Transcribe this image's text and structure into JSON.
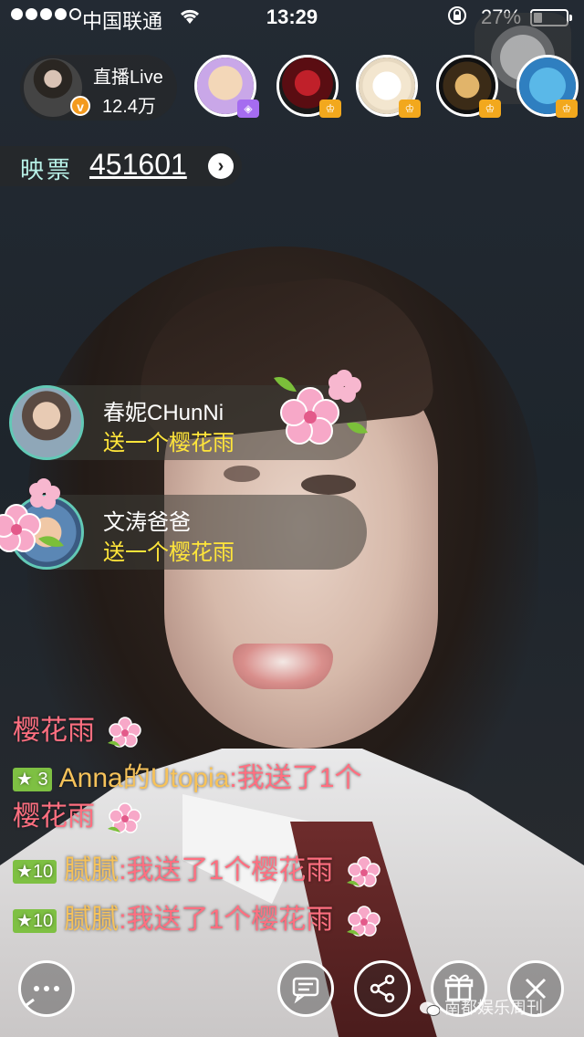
{
  "status_bar": {
    "carrier": "中国联通",
    "time": "13:29",
    "battery_percent": "27%",
    "battery_level": 0.27,
    "signal_bars": 4,
    "signal_max": 5
  },
  "host": {
    "title": "直播Live",
    "viewer_count": "12.4万",
    "badge": "v"
  },
  "viewers": [
    {
      "name": "viewer-cartoon-man",
      "badge_color": "#a56cf0"
    },
    {
      "name": "viewer-rose",
      "badge_color": "#f2a81d"
    },
    {
      "name": "viewer-rabbit",
      "badge_color": "#f2a81d"
    },
    {
      "name": "viewer-mask",
      "badge_color": "#f2a81d"
    },
    {
      "name": "viewer-blue-bunny",
      "badge_color": "#f2a81d"
    }
  ],
  "ticket": {
    "label": "映票",
    "value": "451601",
    "arrow": "›"
  },
  "gifts": [
    {
      "user": "春妮CHunNi",
      "message": "送一个樱花雨"
    },
    {
      "user": "文涛爸爸",
      "message": "送一个樱花雨"
    }
  ],
  "chat": [
    {
      "text": "樱花雨"
    },
    {
      "level": "3",
      "user": "Anna的Utopia",
      "text": ":我送了1个",
      "text2": "樱花雨"
    },
    {
      "level": "10",
      "user": "腻腻",
      "text": ":我送了1个樱花雨"
    },
    {
      "level": "10",
      "user": "腻腻",
      "text": ":我送了1个樱花雨"
    }
  ],
  "watermark": "南都娱乐周刊",
  "colors": {
    "accent_teal": "#62c9b6",
    "gift_yellow": "#ffe53a",
    "chat_pink": "#ff6f80",
    "chat_gold": "#f6c25a",
    "level_green": "#7ec043"
  }
}
